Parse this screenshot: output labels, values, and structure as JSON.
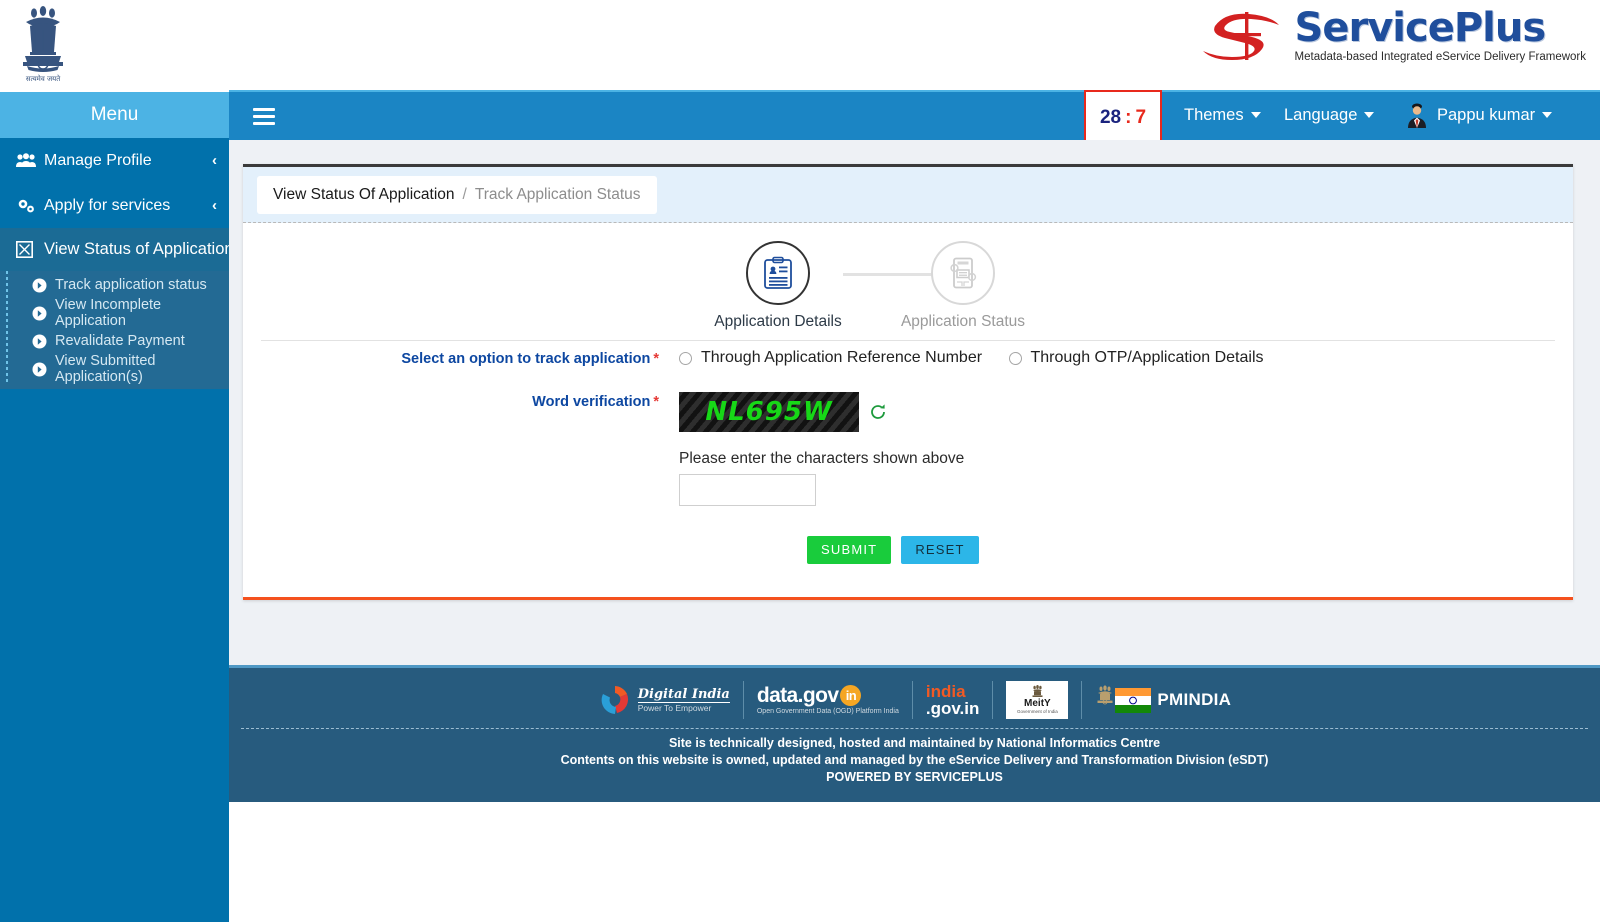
{
  "branding": {
    "emblem_alt": "national-emblem-of-india",
    "emblem_motto": "सत्यमेव जयते",
    "logo_word": "ServicePlus",
    "logo_tagline": "Metadata-based Integrated eService Delivery Framework"
  },
  "menu_header": {
    "label": "Menu"
  },
  "topnav": {
    "timer": {
      "minutes": "28",
      "separator": ":",
      "seconds": "7"
    },
    "themes_label": "Themes",
    "language_label": "Language",
    "user_label": "Pappu kumar"
  },
  "sidebar": {
    "items": [
      {
        "label": "Manage Profile",
        "icon": "users-icon",
        "chevron": "‹"
      },
      {
        "label": "Apply for services",
        "icon": "gears-icon",
        "chevron": "‹"
      },
      {
        "label": "View Status of Application",
        "icon": "boxed-x-icon",
        "chevron": "⌄"
      }
    ],
    "submenu": [
      {
        "label": "Track application status"
      },
      {
        "label": "View Incomplete Application"
      },
      {
        "label": "Revalidate Payment"
      },
      {
        "label": "View Submitted Application(s)"
      }
    ]
  },
  "breadcrumb": {
    "current": "View Status Of Application",
    "separator": "/",
    "sub": "Track Application Status"
  },
  "stepper": {
    "steps": [
      {
        "label": "Application Details",
        "state": "active",
        "icon": "clipboard-person-icon"
      },
      {
        "label": "Application Status",
        "state": "inactive",
        "icon": "document-gears-icon"
      }
    ]
  },
  "form": {
    "track_option": {
      "label": "Select an option to track application",
      "required_mark": "*",
      "options": [
        {
          "label": "Through Application Reference Number",
          "selected": false
        },
        {
          "label": "Through OTP/Application Details",
          "selected": false
        }
      ]
    },
    "word_verification": {
      "label": "Word verification",
      "required_mark": "*",
      "captcha_text": "NL695W",
      "refresh_icon": "refresh-icon"
    },
    "captcha_hint": "Please enter the characters shown above",
    "captcha_input_value": "",
    "captcha_input_placeholder": "",
    "submit_label": "SUBMIT",
    "reset_label": "RESET"
  },
  "footer": {
    "logos": [
      {
        "name": "Digital India",
        "sub": "Power To Empower"
      },
      {
        "name": "data.gov",
        "suffix": "in",
        "sub": "Open Government Data (OGD) Platform India"
      },
      {
        "name": "india",
        "name2": ".gov.in"
      },
      {
        "name": "MeitY",
        "sub": "Government of India"
      },
      {
        "name": "PMINDIA"
      }
    ],
    "lines": [
      "Site is technically designed, hosted and maintained by National Informatics Centre",
      "Contents on this website is owned, updated and managed by the eService Delivery and Transformation Division (eSDT)",
      "POWERED BY SERVICEPLUS"
    ]
  },
  "colors": {
    "sidebar_blue": "#0171ab",
    "menu_header_blue": "#4cb3e4",
    "topnav_blue": "#1b85c4",
    "footer_blue": "#275b7e",
    "submit_green": "#19cc3c",
    "reset_cyan": "#2cb6e8",
    "card_bottom_orange": "#f4511e",
    "label_blue": "#0d47a1",
    "required_red": "#e53935",
    "captcha_green": "#17d817",
    "timer_red": "#e8291c"
  }
}
